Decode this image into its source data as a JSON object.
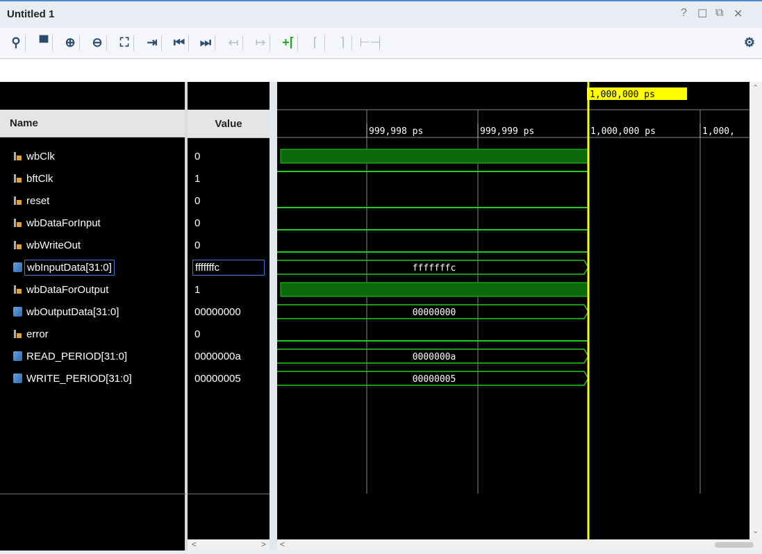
{
  "window": {
    "title": "Untitled 1",
    "help": "?",
    "restore": "☐",
    "float": "⧉",
    "close": "✕"
  },
  "toolbar": [
    {
      "icon": "zoom-search-icon",
      "glyph": "⚲",
      "state": "enabled"
    },
    {
      "icon": "save-icon",
      "glyph": "▀",
      "state": "enabled"
    },
    {
      "icon": "zoom-in-icon",
      "glyph": "⊕",
      "state": "enabled"
    },
    {
      "icon": "zoom-out-icon",
      "glyph": "⊖",
      "state": "enabled"
    },
    {
      "icon": "zoom-fit-icon",
      "glyph": "⛶",
      "state": "enabled"
    },
    {
      "icon": "go-to-cursor-icon",
      "glyph": "⇥",
      "state": "enabled"
    },
    {
      "icon": "go-to-start-icon",
      "glyph": "⏮",
      "state": "enabled"
    },
    {
      "icon": "go-to-end-icon",
      "glyph": "⏭",
      "state": "enabled"
    },
    {
      "icon": "previous-transition-icon",
      "glyph": "↤",
      "state": "disabled"
    },
    {
      "icon": "next-transition-icon",
      "glyph": "↦",
      "state": "disabled"
    },
    {
      "icon": "add-marker-icon",
      "glyph": "+⌈",
      "state": "enabled-green"
    },
    {
      "icon": "previous-marker-icon",
      "glyph": "⌈",
      "state": "disabled"
    },
    {
      "icon": "next-marker-icon",
      "glyph": "⌉",
      "state": "disabled"
    },
    {
      "icon": "swap-cursors-icon",
      "glyph": "⊢⊣",
      "state": "disabled"
    },
    {
      "icon": "settings-gear-icon",
      "glyph": "⚙",
      "state": "enabled"
    }
  ],
  "columns": {
    "name": "Name",
    "value": "Value"
  },
  "cursor": {
    "time": "1,000,000 ps",
    "color": "#ffff00"
  },
  "time_ruler": [
    "999,998 ps",
    "999,999 ps",
    "1,000,000 ps",
    "1,000,"
  ],
  "signals": [
    {
      "name": "wbClk",
      "value": "0",
      "kind": "bit",
      "wave": "low-filled"
    },
    {
      "name": "bftClk",
      "value": "1",
      "kind": "bit",
      "wave": "high"
    },
    {
      "name": "reset",
      "value": "0",
      "kind": "bit",
      "wave": "low"
    },
    {
      "name": "wbDataForInput",
      "value": "0",
      "kind": "bit",
      "wave": "low"
    },
    {
      "name": "wbWriteOut",
      "value": "0",
      "kind": "bit",
      "wave": "low"
    },
    {
      "name": "wbInputData[31:0]",
      "value": "fffffffc",
      "kind": "bus",
      "wave": "bus",
      "bus_label": "fffffffc",
      "selected": true
    },
    {
      "name": "wbDataForOutput",
      "value": "1",
      "kind": "bit",
      "wave": "high-filled"
    },
    {
      "name": "wbOutputData[31:0]",
      "value": "00000000",
      "kind": "bus",
      "wave": "bus",
      "bus_label": "00000000"
    },
    {
      "name": "error",
      "value": "0",
      "kind": "bit",
      "wave": "low"
    },
    {
      "name": "READ_PERIOD[31:0]",
      "value": "0000000a",
      "kind": "bus",
      "wave": "bus",
      "bus_label": "0000000a"
    },
    {
      "name": "WRITE_PERIOD[31:0]",
      "value": "00000005",
      "kind": "bus",
      "wave": "bus",
      "bus_label": "00000005"
    }
  ],
  "colors": {
    "wave": "#22cc22",
    "wave_fill": "#0a6a0a",
    "grid": "#8a8a8a",
    "background": "#000000"
  }
}
